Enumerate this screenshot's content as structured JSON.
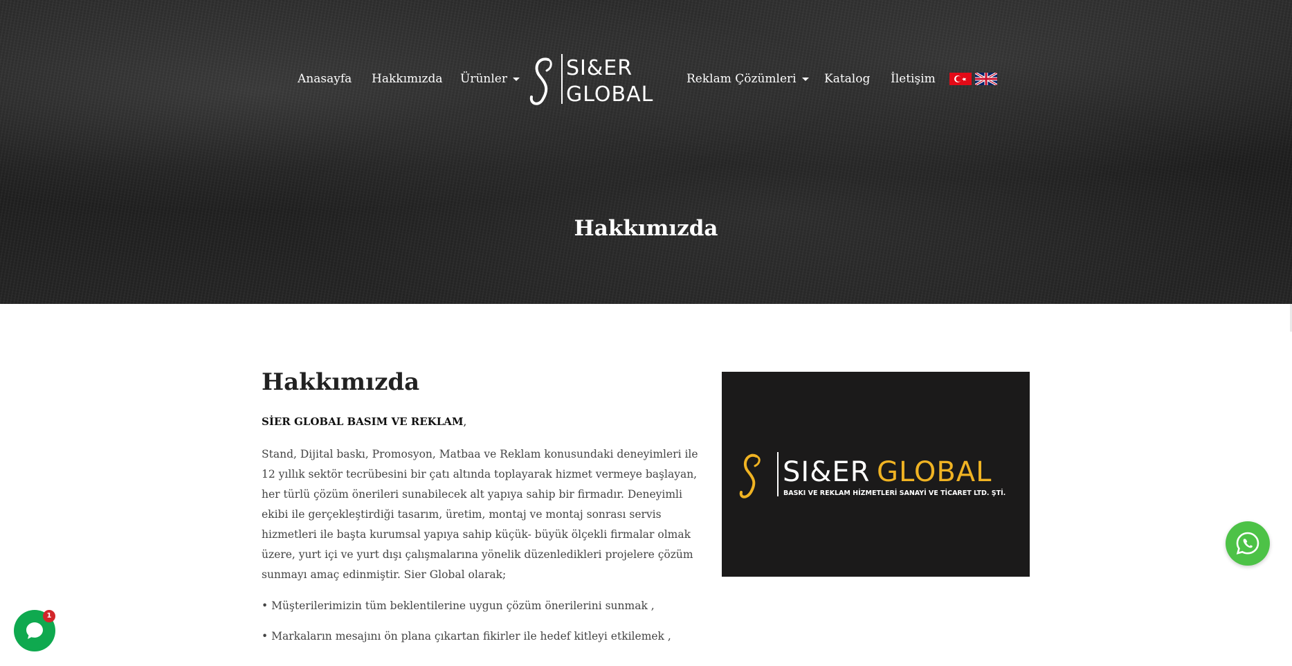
{
  "nav": {
    "items": [
      {
        "label": "Anasayfa"
      },
      {
        "label": "Hakkımızda"
      },
      {
        "label": "Ürünler"
      },
      {
        "label": "Reklam Çözümleri"
      },
      {
        "label": "Katalog"
      },
      {
        "label": "İletişim"
      }
    ],
    "logo_text_top": "SI&ER",
    "logo_text_bottom": "GLOBAL",
    "flags": [
      "turkey-flag-icon",
      "uk-flag-icon"
    ]
  },
  "hero": {
    "title": "Hakkımızda"
  },
  "main": {
    "heading": "Hakkımızda",
    "company_name": "SİER GLOBAL BASIM VE REKLAM",
    "company_suffix": ",",
    "paragraph": "Stand, Dijital baskı, Promosyon, Matbaa ve Reklam konusundaki deneyimleri ile 12 yıllık sektör tecrübesini bir çatı altında toplayarak hizmet vermeye başlayan, her türlü çözüm önerileri sunabilecek alt yapıya sahip bir firmadır. Deneyimli ekibi ile gerçekleştirdiği tasarım, üretim, montaj ve montaj sonrası servis hizmetleri ile başta kurumsal yapıya sahip küçük- büyük ölçekli firmalar olmak üzere, yurt içi ve yurt dışı çalışmalarına yönelik düzenledikleri projelere çözüm sunmayı amaç edinmiştir. Sier Global olarak;",
    "bullets": [
      "• Müşterilerimizin tüm beklentilerine uygun çözüm önerilerini sunmak ,",
      "• Markaların mesajını ön plana çıkartan fikirler ile hedef kitleyi etkilemek ,"
    ]
  },
  "brand_image": {
    "name_white": "SI&ER",
    "name_gold": "GLOBAL",
    "tagline": "BASKI VE REKLAM HİZMETLERİ SANAYİ VE TİCARET LTD. ŞTİ.",
    "gold_color": "#f0b323"
  },
  "chat_widget": {
    "badge_count": "1"
  },
  "colors": {
    "whatsapp_green": "#4dc247",
    "chat_green": "#0fa94f",
    "badge_red": "#d2262a"
  }
}
